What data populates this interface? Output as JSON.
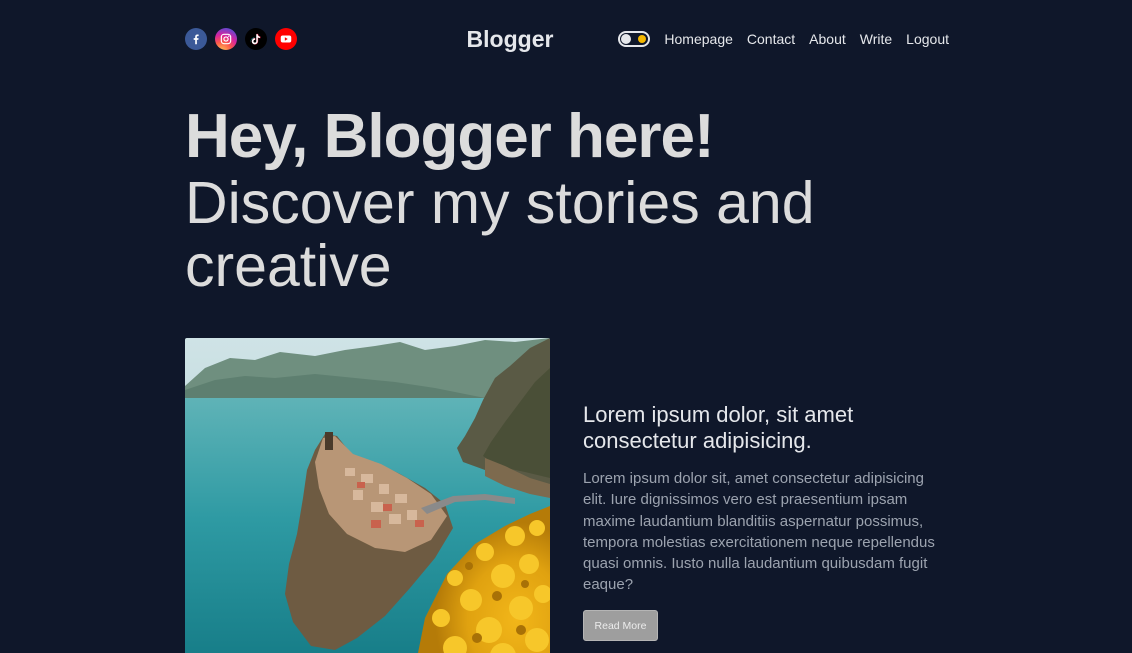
{
  "brand": {
    "name": "Blogger"
  },
  "socials": [
    {
      "name": "facebook",
      "icon": "facebook-icon",
      "color": "#3b5998"
    },
    {
      "name": "instagram",
      "icon": "instagram-icon",
      "color": "#d6249f"
    },
    {
      "name": "tiktok",
      "icon": "tiktok-icon",
      "color": "#000000"
    },
    {
      "name": "youtube",
      "icon": "youtube-icon",
      "color": "#ff0000"
    }
  ],
  "theme_toggle": {
    "icon": "sun-icon",
    "accent": "#f5b800"
  },
  "nav": {
    "links": [
      "Homepage",
      "Contact",
      "About",
      "Write",
      "Logout"
    ]
  },
  "hero": {
    "bold": "Hey, Blogger here!",
    "light": "Discover my stories and creative"
  },
  "featured_post": {
    "title": "Lorem ipsum dolor, sit amet consectetur adipisicing.",
    "excerpt": "Lorem ipsum dolor sit, amet consectetur adipisicing elit. Iure dignissimos vero est praesentium ipsam maxime laudantium blanditiis aspernatur possimus, tempora molestias exercitationem neque repellendus quasi omnis. Iusto nulla laudantium quibusdam fugit eaque?",
    "button": "Read More"
  },
  "colors": {
    "background": "#0f172a",
    "text": "#e5e7eb",
    "muted_text": "#9ca3af",
    "button_bg": "#9e9e9e"
  }
}
